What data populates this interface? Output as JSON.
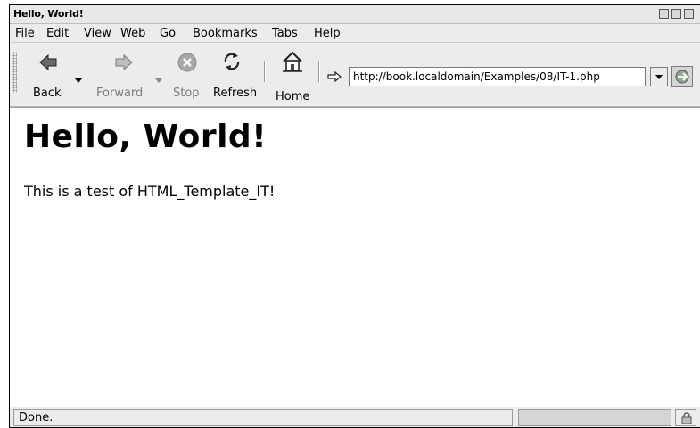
{
  "window": {
    "title": "Hello, World!"
  },
  "menubar": {
    "items": [
      "File",
      "Edit",
      "View",
      "Web",
      "Go",
      "Bookmarks",
      "Tabs",
      "Help"
    ]
  },
  "toolbar": {
    "back_label": "Back",
    "forward_label": "Forward",
    "stop_label": "Stop",
    "refresh_label": "Refresh",
    "home_label": "Home",
    "url": "http://book.localdomain/Examples/08/IT-1.php"
  },
  "page": {
    "heading": "Hello, World!",
    "body_text": "This is a test of HTML_Template_IT!"
  },
  "statusbar": {
    "text": "Done."
  },
  "icons": {
    "back": "back-arrow-icon",
    "forward": "forward-arrow-icon",
    "stop": "stop-icon",
    "refresh": "refresh-icon",
    "home": "home-icon",
    "url_prefix": "page-link-icon",
    "go": "go-icon",
    "security": "lock-icon"
  }
}
